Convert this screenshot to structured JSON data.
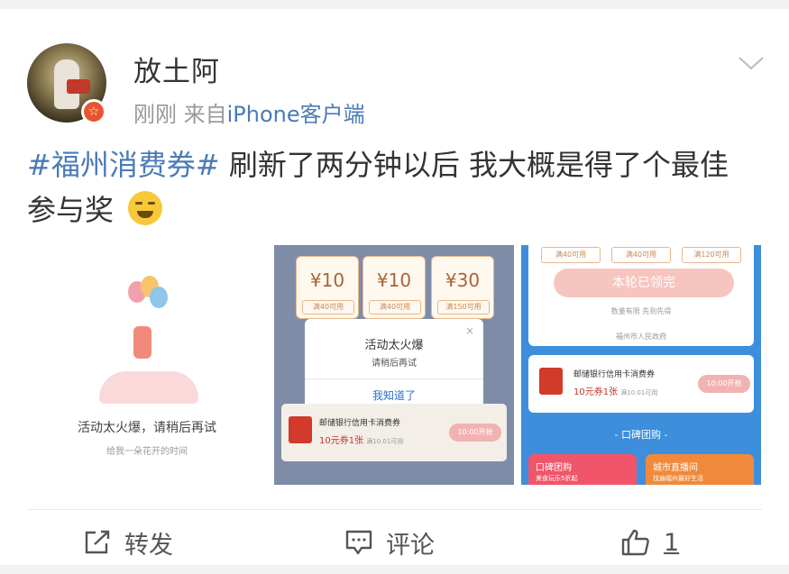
{
  "post": {
    "username": "放土阿",
    "time": "刚刚",
    "source_prefix": "来自",
    "source": "iPhone客户端",
    "topic": "#福州消费券#",
    "text": " 刷新了两分钟以后 我大概是得了个最佳参与奖"
  },
  "images": {
    "img1": {
      "error_title": "活动太火爆，请稍后再试",
      "error_sub": "给我一朵花开的时间"
    },
    "img2": {
      "coupons": [
        {
          "value": "¥10",
          "cond": "满40可用"
        },
        {
          "value": "¥10",
          "cond": "满40可用"
        },
        {
          "value": "¥30",
          "cond": "满150可用"
        }
      ],
      "dialog_title": "活动太火爆",
      "dialog_sub": "请稍后再试",
      "dialog_close": "×",
      "dialog_ok": "我知道了",
      "bank_name": "邮储银行信用卡消费券",
      "bank_amount": "10元券1张",
      "bank_note": "满10.01可用",
      "bank_button": "10:00开抢"
    },
    "img3": {
      "tags": [
        "满40可用",
        "满40可用",
        "满120可用"
      ],
      "claimed_button": "本轮已领完",
      "limited_note": "数量有限 先到先得",
      "gov_note": "福州市人民政府",
      "bank_name": "邮储银行信用卡消费券",
      "bank_amount": "10元券1张",
      "bank_note": "满10.01可用",
      "bank_button": "10:00开抢",
      "section_title": "- 口碑团购 -",
      "tiles": [
        {
          "title": "口碑团购",
          "sub": "美食玩乐5折起",
          "color": "#f0556a"
        },
        {
          "title": "城市直播间",
          "sub": "找遍福州最好生活",
          "color": "#f08a3a"
        }
      ]
    }
  },
  "actions": {
    "repost": "转发",
    "comment": "评论",
    "like_count": "1"
  }
}
